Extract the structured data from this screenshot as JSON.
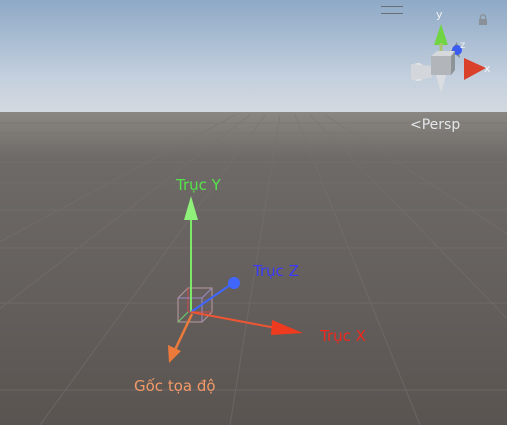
{
  "scene_view": {
    "projection_label": "Persp",
    "gizmo_axes": {
      "y": "y",
      "z": "z",
      "x": "x"
    }
  },
  "annotations": {
    "axis_y": "Trục Y",
    "axis_z": "Trục Z",
    "axis_x": "Trục X",
    "origin": "Gốc tọa độ"
  },
  "colors": {
    "axis_y": "#55e34a",
    "axis_z": "#3a3aff",
    "axis_x": "#f0281e",
    "origin": "#f39a68",
    "ground": "#5b5552",
    "sky": "#a9c0d8"
  },
  "icons": [
    "menu-icon",
    "lock-icon",
    "orientation-gizmo-icon"
  ]
}
